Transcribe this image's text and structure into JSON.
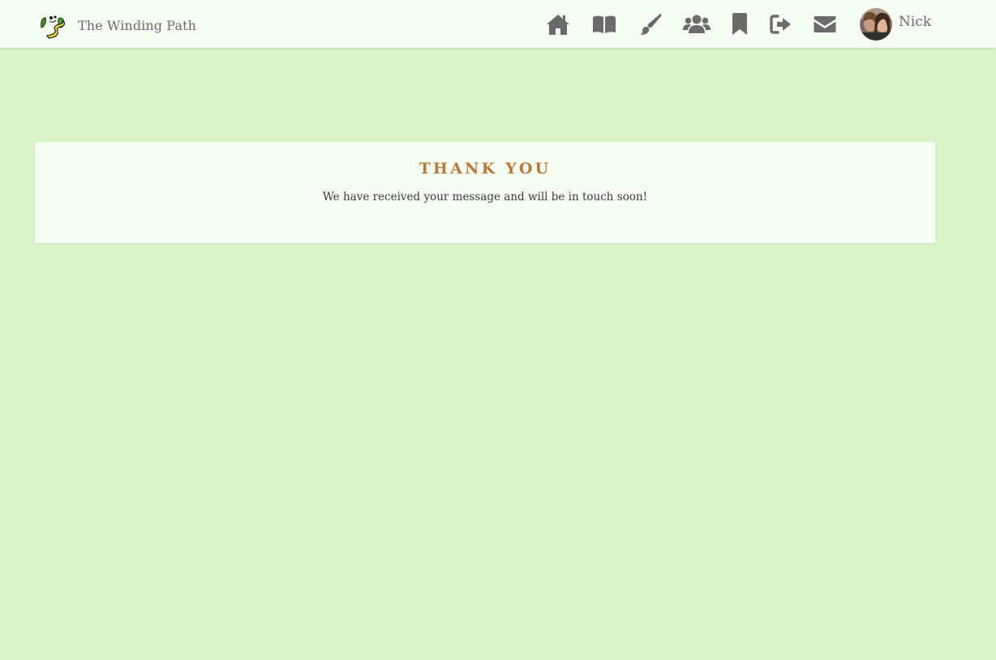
{
  "brand": {
    "name": "The Winding Path",
    "logo_icon": "winding-path-logo-icon"
  },
  "nav": {
    "items": [
      {
        "icon": "home-icon",
        "label": "Home"
      },
      {
        "icon": "book-icon",
        "label": "Read"
      },
      {
        "icon": "paintbrush-icon",
        "label": "Create"
      },
      {
        "icon": "users-icon",
        "label": "Community"
      },
      {
        "icon": "bookmark-icon",
        "label": "Bookmarks"
      },
      {
        "icon": "sign-out-icon",
        "label": "Sign out"
      },
      {
        "icon": "envelope-icon",
        "label": "Contact"
      }
    ],
    "icon_color": "#6b6b6b"
  },
  "user": {
    "name": "Nick"
  },
  "confirmation": {
    "title": "THANK YOU",
    "message": "We have received your message and will be in touch soon!"
  },
  "colors": {
    "page_background": "#d8f4c8",
    "surface": "#f6fdf2",
    "title_accent": "#b87a34"
  }
}
